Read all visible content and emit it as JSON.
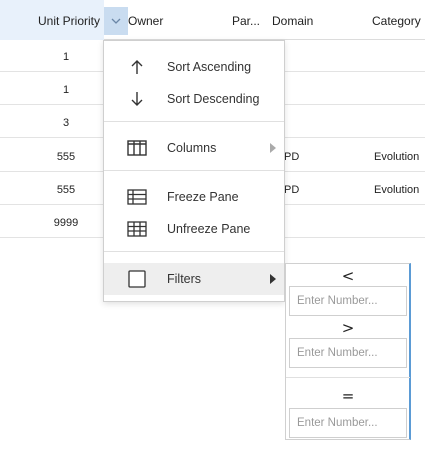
{
  "header": {
    "unit_priority": "Unit Priority",
    "owner": "Owner",
    "par": "Par...",
    "domain": "Domain",
    "category": "Category"
  },
  "rows": [
    {
      "unit_priority": "1",
      "domain": "",
      "category": ""
    },
    {
      "unit_priority": "1",
      "domain": "",
      "category": ""
    },
    {
      "unit_priority": "3",
      "domain": "",
      "category": ""
    },
    {
      "unit_priority": "555",
      "domain": "PD",
      "category": "Evolution"
    },
    {
      "unit_priority": "555",
      "domain": "PD",
      "category": "Evolution"
    },
    {
      "unit_priority": "9999",
      "domain": "",
      "category": ""
    }
  ],
  "menu": {
    "sort_asc": "Sort Ascending",
    "sort_desc": "Sort Descending",
    "columns": "Columns",
    "freeze": "Freeze Pane",
    "unfreeze": "Unfreeze Pane",
    "filters": "Filters"
  },
  "filters": {
    "less_than": "<",
    "greater_than": ">",
    "equals": "=",
    "placeholder": "Enter Number..."
  },
  "icons": {
    "menu_button": "chevron-down-icon",
    "sort_asc": "arrow-up-icon",
    "sort_desc": "arrow-down-icon",
    "columns": "columns-icon",
    "freeze": "freeze-pane-icon",
    "unfreeze": "unfreeze-pane-icon",
    "filters": "checkbox-icon"
  },
  "colors": {
    "header_active_bg": "#e8f1fb",
    "menu_button_bg": "#c9dcf0",
    "submenu_accent": "#5b9bd5"
  }
}
